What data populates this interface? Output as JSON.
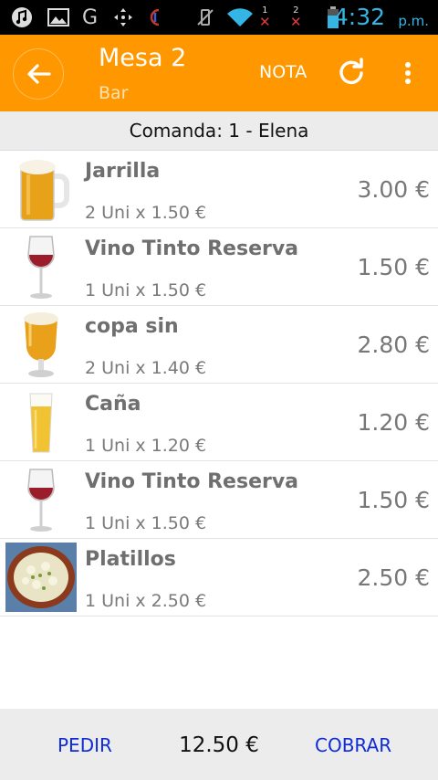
{
  "status_bar": {
    "time": "4:32",
    "ampm": "p.m.",
    "icons": [
      "music-icon",
      "gallery-icon",
      "google-icon",
      "move-icon",
      "app-icon",
      "vibrate-mute-icon",
      "wifi-icon",
      "sim1-no-signal-icon",
      "sim2-no-signal-icon",
      "battery-icon"
    ],
    "sim1_label": "1",
    "sim2_label": "2",
    "google_glyph": "G"
  },
  "action_bar": {
    "title": "Mesa 2",
    "subtitle": "Bar",
    "nota_label": "NOTA",
    "color": "#ff9800"
  },
  "comanda": {
    "label": "Comanda: 1 - Elena"
  },
  "items": [
    {
      "name": "Jarrilla",
      "detail": "2 Uni x 1.50 €",
      "price": "3.00 €",
      "icon": "beer-mug-icon"
    },
    {
      "name": "Vino Tinto Reserva",
      "detail": "1 Uni x 1.50 €",
      "price": "1.50 €",
      "icon": "wine-glass-icon"
    },
    {
      "name": "copa sin",
      "detail": "2 Uni x 1.40 €",
      "price": "2.80 €",
      "icon": "beer-goblet-icon"
    },
    {
      "name": "Caña",
      "detail": "1 Uni x 1.20 €",
      "price": "1.20 €",
      "icon": "beer-glass-icon"
    },
    {
      "name": "Vino Tinto Reserva",
      "detail": "1 Uni x 1.50 €",
      "price": "1.50 €",
      "icon": "wine-glass-icon"
    },
    {
      "name": "Platillos",
      "detail": "1 Uni x 2.50 €",
      "price": "2.50 €",
      "icon": "food-plate-icon"
    }
  ],
  "bottom_bar": {
    "pedir_label": "PEDIR",
    "total": "12.50 €",
    "cobrar_label": "COBRAR",
    "link_color": "#0d2bd6"
  }
}
